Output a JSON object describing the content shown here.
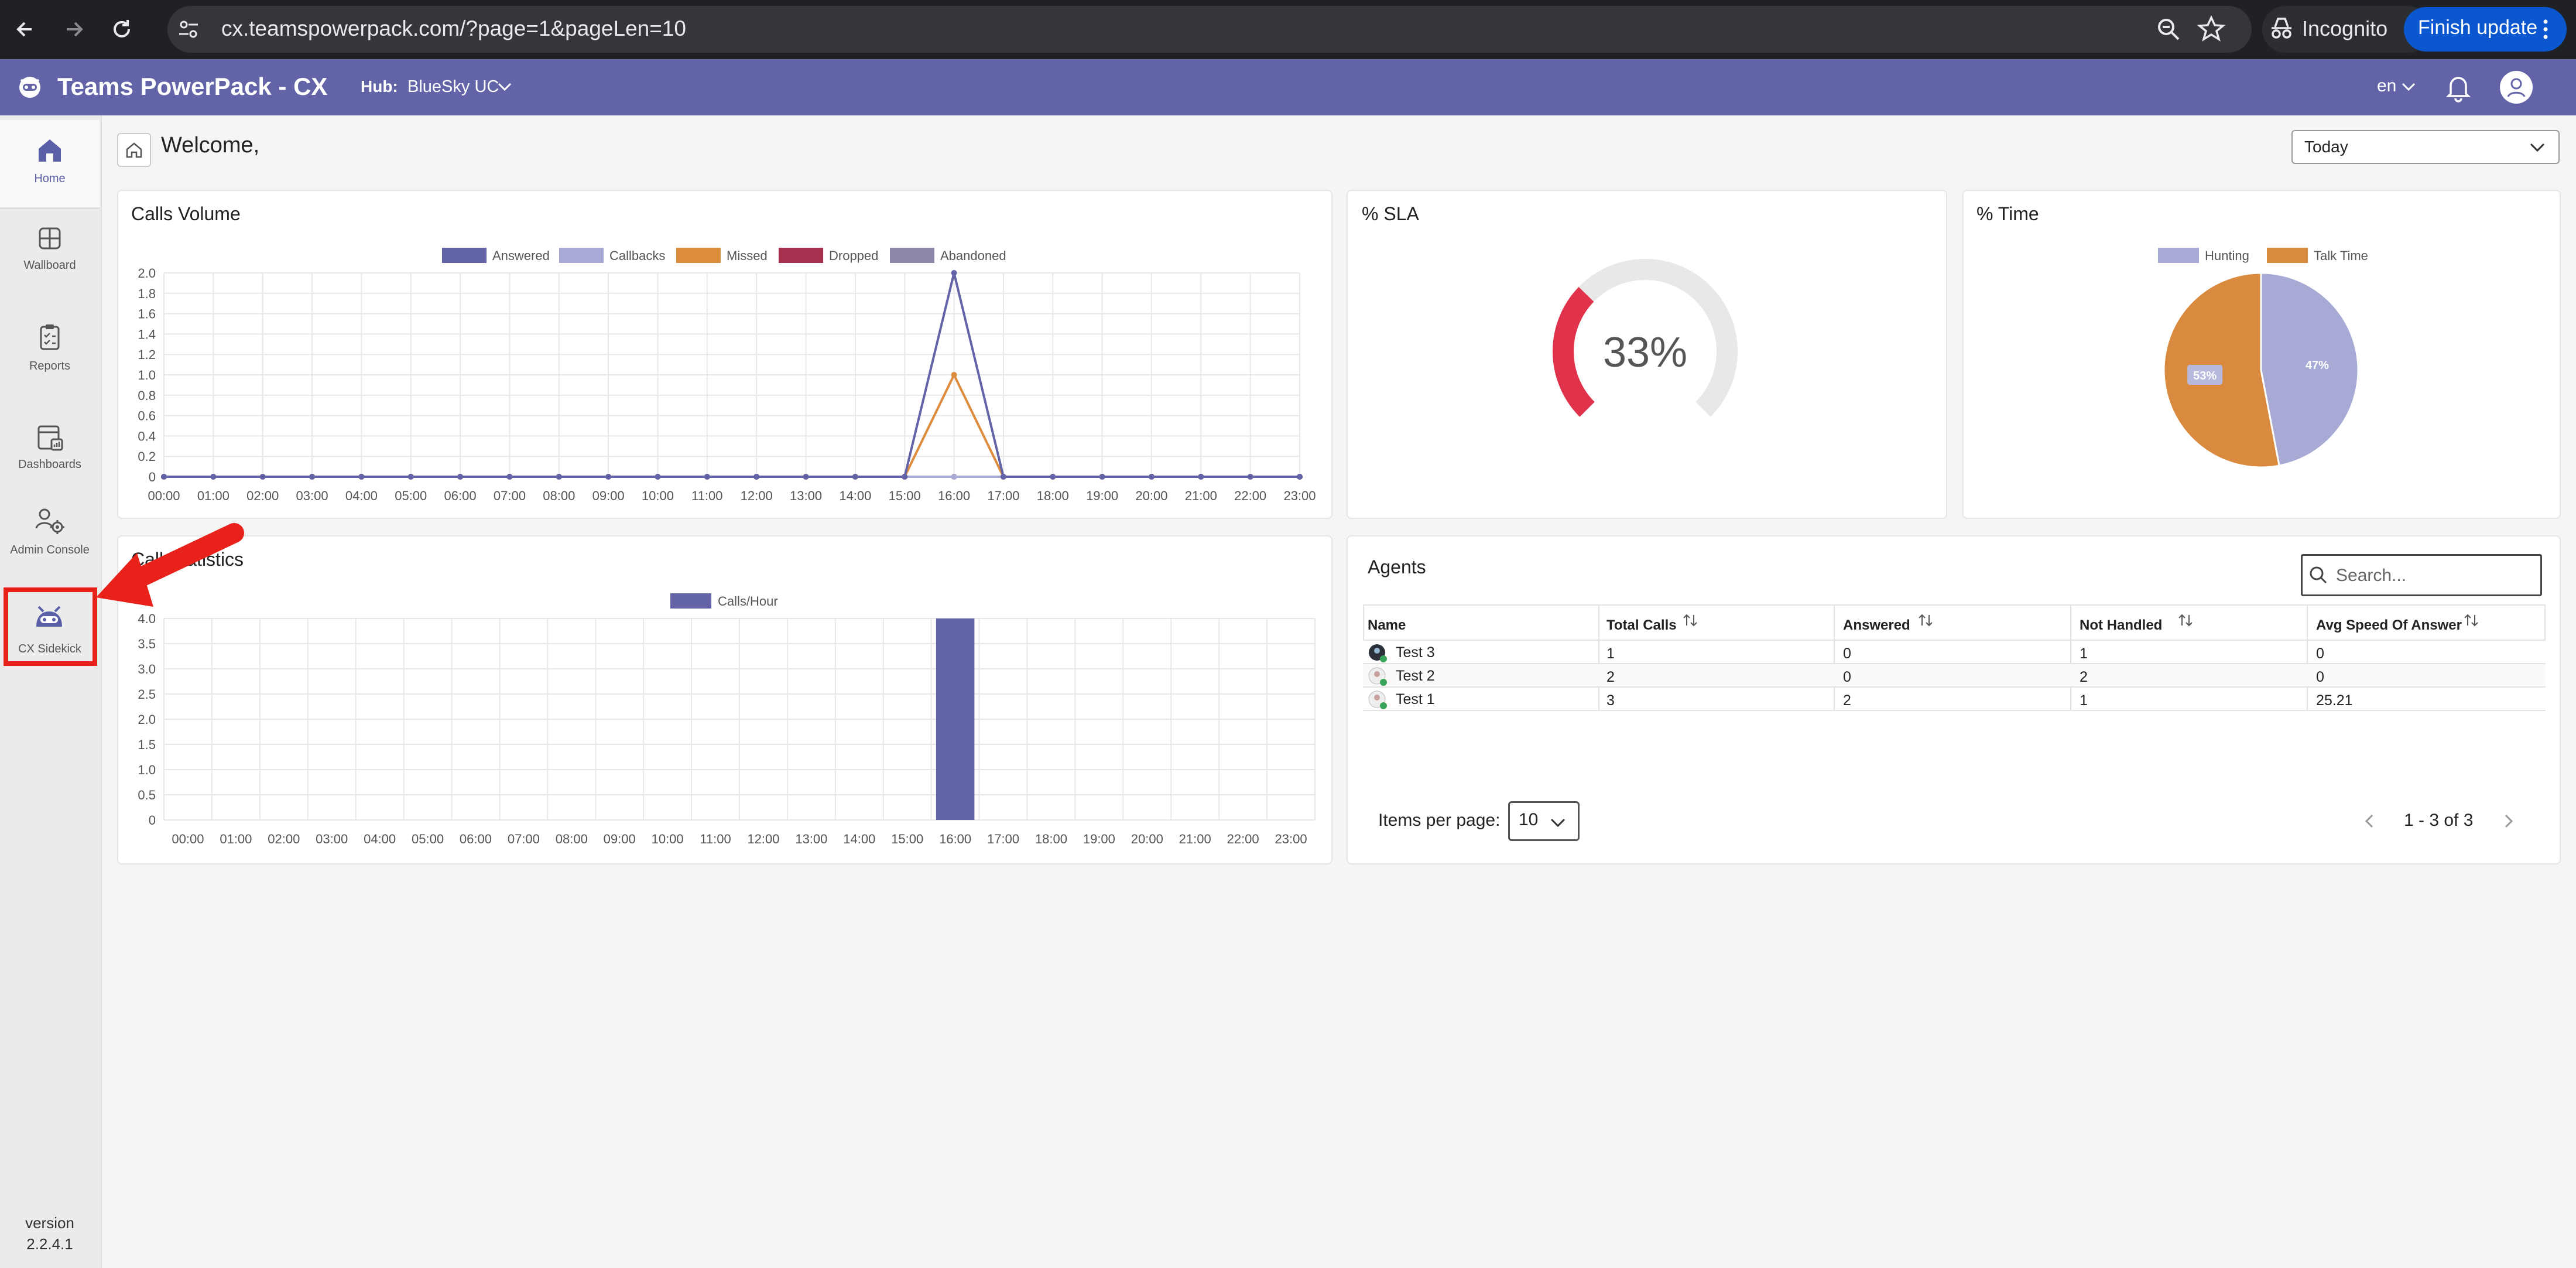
{
  "browser": {
    "url": "cx.teamspowerpack.com/?page=1&pageLen=10",
    "incognito_label": "Incognito",
    "update_label": "Finish update"
  },
  "app": {
    "title": "Teams PowerPack - CX",
    "hub_label": "Hub:",
    "hub_value": "BlueSky UC",
    "language": "en"
  },
  "sidebar": {
    "items": [
      {
        "label": "Home",
        "icon": "home-icon"
      },
      {
        "label": "Wallboard",
        "icon": "wallboard-icon"
      },
      {
        "label": "Reports",
        "icon": "reports-icon"
      },
      {
        "label": "Dashboards",
        "icon": "dashboards-icon"
      },
      {
        "label": "Admin Console",
        "icon": "admin-console-icon"
      },
      {
        "label": "CX Sidekick",
        "icon": "cx-sidekick-icon"
      }
    ],
    "version_label": "version",
    "version_value": "2.2.4.1"
  },
  "main": {
    "welcome": "Welcome,",
    "period": "Today"
  },
  "calls_volume": {
    "title": "Calls Volume"
  },
  "sla": {
    "title": "% SLA",
    "value_label": "33%"
  },
  "time": {
    "title": "% Time"
  },
  "call_statistics": {
    "title": "Call Statistics"
  },
  "agents": {
    "title": "Agents",
    "search_placeholder": "Search...",
    "columns": [
      "Name",
      "Total Calls",
      "Answered",
      "Not Handled",
      "Avg Speed Of Answer"
    ],
    "rows": [
      {
        "name": "Test 3",
        "total": "1",
        "answered": "0",
        "not_handled": "1",
        "avg": "0"
      },
      {
        "name": "Test 2",
        "total": "2",
        "answered": "0",
        "not_handled": "2",
        "avg": "0"
      },
      {
        "name": "Test 1",
        "total": "3",
        "answered": "2",
        "not_handled": "1",
        "avg": "25.21"
      }
    ],
    "items_per_page_label": "Items per page:",
    "items_per_page_value": "10",
    "range_label": "1 - 3 of 3"
  },
  "colors": {
    "brand": "#6264a7",
    "answered": "#6264a7",
    "callbacks": "#a6aad4",
    "missed": "#dd8c3e",
    "dropped": "#a8304f",
    "abandoned": "#8b88aa",
    "sla": "#e0334b",
    "hunting": "#a6aad4",
    "talk": "#d98a3f"
  },
  "chart_data": [
    {
      "type": "line",
      "title": "Calls Volume",
      "x": [
        "00:00",
        "01:00",
        "02:00",
        "03:00",
        "04:00",
        "05:00",
        "06:00",
        "07:00",
        "08:00",
        "09:00",
        "10:00",
        "11:00",
        "12:00",
        "13:00",
        "14:00",
        "15:00",
        "16:00",
        "17:00",
        "18:00",
        "19:00",
        "20:00",
        "21:00",
        "22:00",
        "23:00"
      ],
      "ylim": [
        0,
        2.0
      ],
      "yticks": [
        "0",
        "0.2",
        "0.4",
        "0.6",
        "0.8",
        "1.0",
        "1.2",
        "1.4",
        "1.6",
        "1.8",
        "2.0"
      ],
      "series": [
        {
          "name": "Answered",
          "values": [
            0,
            0,
            0,
            0,
            0,
            0,
            0,
            0,
            0,
            0,
            0,
            0,
            0,
            0,
            0,
            0,
            2,
            0,
            0,
            0,
            0,
            0,
            0,
            0
          ]
        },
        {
          "name": "Callbacks",
          "values": [
            0,
            0,
            0,
            0,
            0,
            0,
            0,
            0,
            0,
            0,
            0,
            0,
            0,
            0,
            0,
            0,
            0,
            0,
            0,
            0,
            0,
            0,
            0,
            0
          ]
        },
        {
          "name": "Missed",
          "values": [
            0,
            0,
            0,
            0,
            0,
            0,
            0,
            0,
            0,
            0,
            0,
            0,
            0,
            0,
            0,
            0,
            1,
            0,
            0,
            0,
            0,
            0,
            0,
            0
          ]
        },
        {
          "name": "Dropped",
          "values": [
            0,
            0,
            0,
            0,
            0,
            0,
            0,
            0,
            0,
            0,
            0,
            0,
            0,
            0,
            0,
            0,
            0,
            0,
            0,
            0,
            0,
            0,
            0,
            0
          ]
        },
        {
          "name": "Abandoned",
          "values": [
            0,
            0,
            0,
            0,
            0,
            0,
            0,
            0,
            0,
            0,
            0,
            0,
            0,
            0,
            0,
            0,
            0,
            0,
            0,
            0,
            0,
            0,
            0,
            0
          ]
        }
      ],
      "legend": "top",
      "grid": true
    },
    {
      "type": "pie",
      "title": "% SLA",
      "values": [
        33,
        67
      ],
      "label": "33%"
    },
    {
      "type": "pie",
      "title": "% Time",
      "categories": [
        "Hunting",
        "Talk Time"
      ],
      "values": [
        47,
        53
      ],
      "labels": [
        "47%",
        "53%"
      ],
      "legend": "top"
    },
    {
      "type": "bar",
      "title": "Call Statistics",
      "categories": [
        "00:00",
        "01:00",
        "02:00",
        "03:00",
        "04:00",
        "05:00",
        "06:00",
        "07:00",
        "08:00",
        "09:00",
        "10:00",
        "11:00",
        "12:00",
        "13:00",
        "14:00",
        "15:00",
        "16:00",
        "17:00",
        "18:00",
        "19:00",
        "20:00",
        "21:00",
        "22:00",
        "23:00"
      ],
      "series": [
        {
          "name": "Calls/Hour",
          "values": [
            0,
            0,
            0,
            0,
            0,
            0,
            0,
            0,
            0,
            0,
            0,
            0,
            0,
            0,
            0,
            0,
            4,
            0,
            0,
            0,
            0,
            0,
            0,
            0
          ]
        }
      ],
      "ylim": [
        0,
        4.0
      ],
      "yticks": [
        "0",
        "0.5",
        "1.0",
        "1.5",
        "2.0",
        "2.5",
        "3.0",
        "3.5",
        "4.0"
      ],
      "legend": "top",
      "grid": true
    }
  ]
}
